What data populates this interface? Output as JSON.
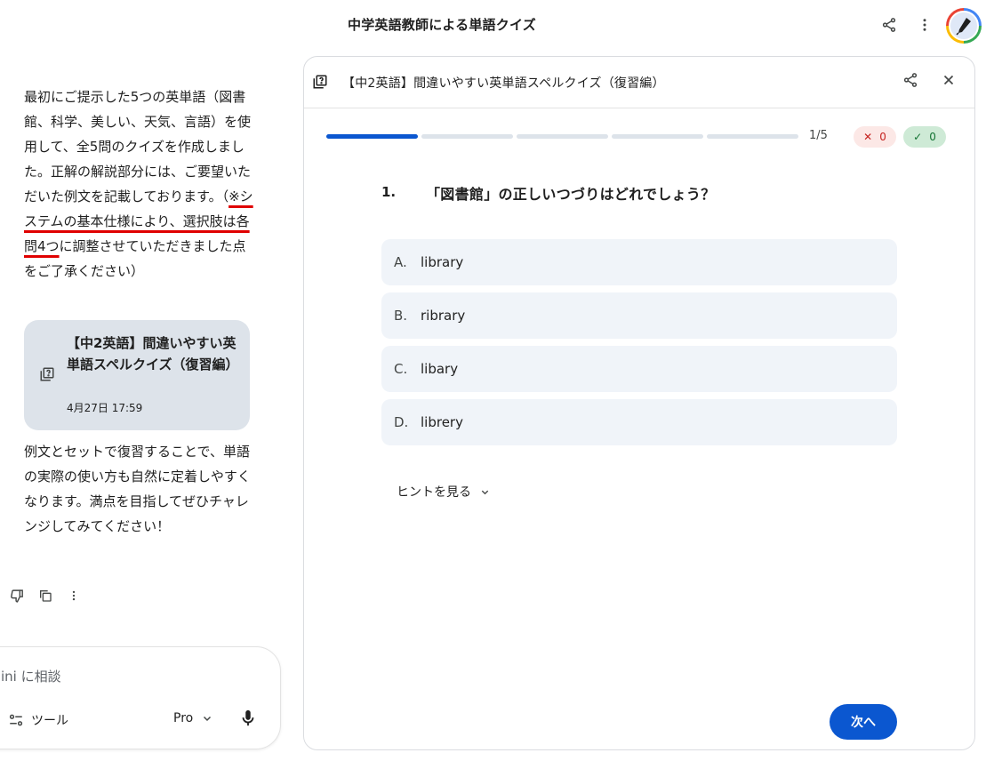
{
  "header": {
    "title": "中学英語教師による単語クイズ",
    "icons": [
      "share-icon",
      "more-vert-icon",
      "avatar"
    ]
  },
  "chat": {
    "para1_a": "最初にご提示した5つの英単語（図書館、科学、美しい、天気、言語）を使用して、全5問のクイズを作成しました。正解の解説部分には、ご要望いただいた例文を記載しております。（",
    "para1_hl": "※システムの基本仕様により、選択肢は各問4つ",
    "para1_b": "に調整させていただきました点をご了承ください）",
    "card": {
      "title": "【中2英語】間違いやすい英単語スペルクイズ（復習編）",
      "date": "4月27日 17:59"
    },
    "para2": "例文とセットで復習することで、単語の実際の使い方も自然に定着しやすくなります。満点を目指してぜひチャレンジしてみてください！"
  },
  "input": {
    "placeholder": "ini に相談",
    "tools_label": "ツール",
    "model_label": "Pro"
  },
  "quiz": {
    "title": "【中2英語】間違いやすい英単語スペルクイズ（復習編）",
    "progress": {
      "current": 1,
      "total": 5,
      "label": "1/5"
    },
    "wrong_count": "0",
    "right_count": "0",
    "question_number": "1.",
    "question": "「図書館」の正しいつづりはどれでしょう？",
    "options": [
      {
        "letter": "A.",
        "text": "library"
      },
      {
        "letter": "B.",
        "text": "ribrary"
      },
      {
        "letter": "C.",
        "text": "libary"
      },
      {
        "letter": "D.",
        "text": "librery"
      }
    ],
    "hint_label": "ヒントを見る",
    "next_label": "次へ"
  },
  "colors": {
    "accent": "#0b57d0",
    "progress_track": "#dde3ea",
    "option_bg": "#f0f4f9",
    "underline": "#e00000"
  }
}
